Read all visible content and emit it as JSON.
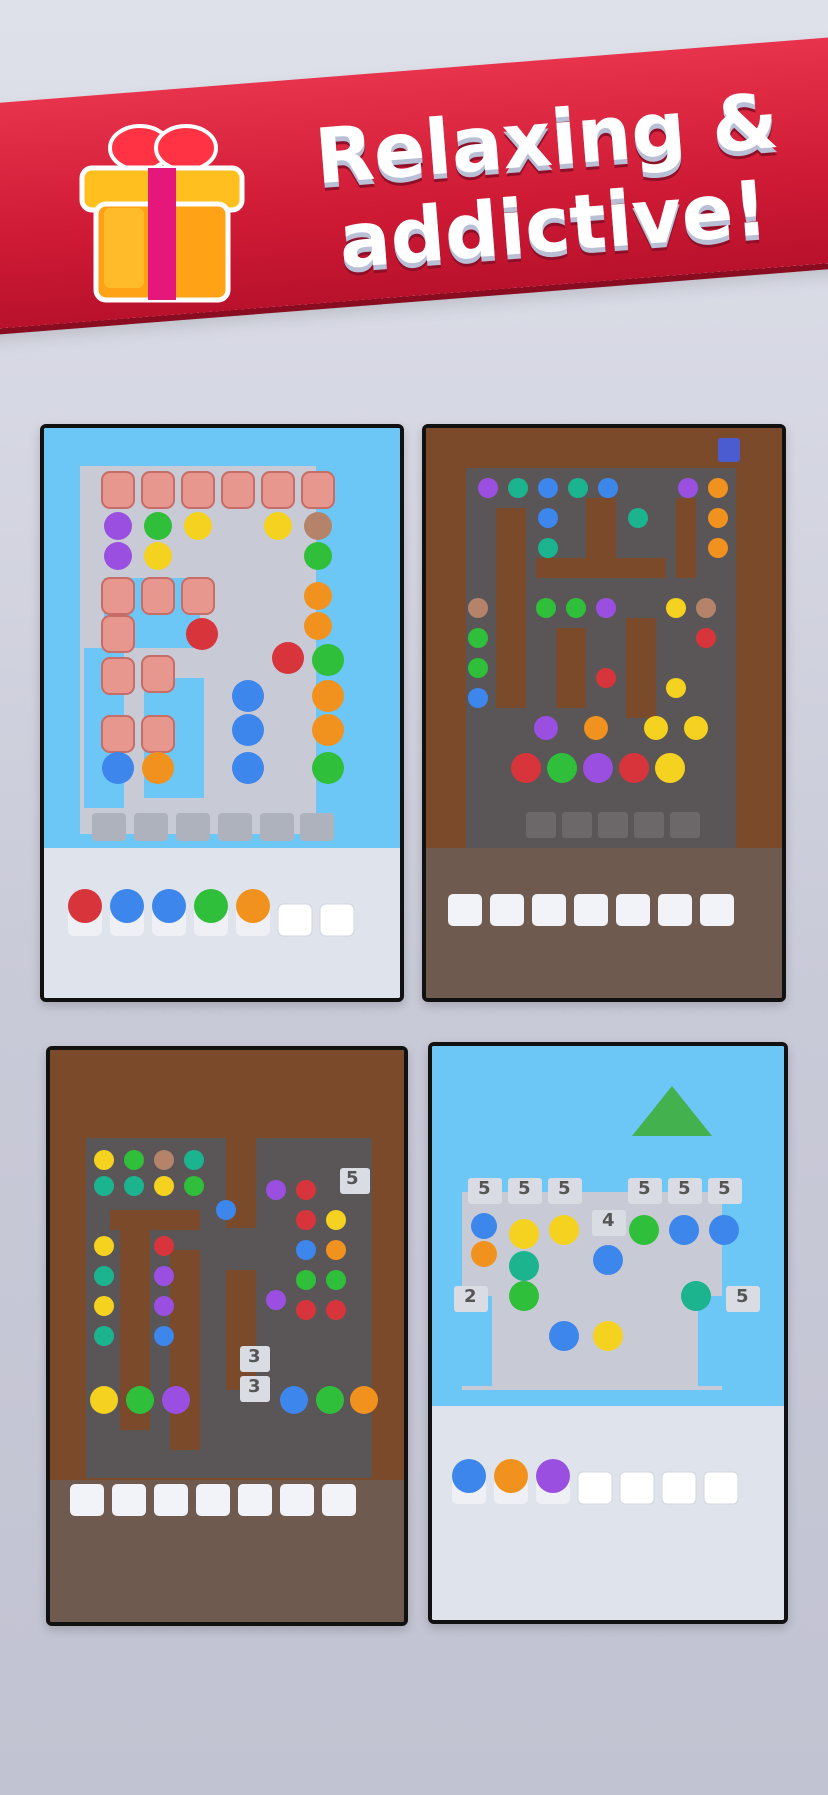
{
  "banner": {
    "line1": "Relaxing &",
    "line2": "addictive!",
    "gift_icon": "gift-icon",
    "color": "#d41d38"
  },
  "panels": [
    {
      "name": "level-panel-1",
      "theme": "blue",
      "tray_slots": 7
    },
    {
      "name": "level-panel-2",
      "theme": "brown",
      "tray_slots": 7
    },
    {
      "name": "level-panel-3",
      "theme": "brown",
      "tray_slots": 7
    },
    {
      "name": "level-panel-4",
      "theme": "blue",
      "tray_slots": 7
    }
  ],
  "counters": {
    "p3_top": "5",
    "p3_a": "3",
    "p3_b": "3",
    "p4_row": [
      "5",
      "5",
      "5",
      "5",
      "5",
      "5"
    ],
    "p4_mid": "4",
    "p4_left": "2",
    "p4_right": "5"
  },
  "colors": {
    "pink_block": "#e8978f",
    "purple": "#9a4fe0",
    "green": "#2fbf3a",
    "yellow": "#f5d21f",
    "blue": "#3d86ec",
    "orange": "#f2921e",
    "red": "#d8343c",
    "teal": "#1bb48f",
    "brown_wall": "#7a4523",
    "water": "#6cc6f6"
  }
}
